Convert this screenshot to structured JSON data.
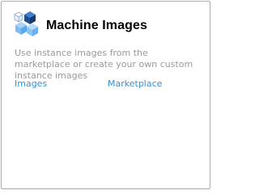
{
  "card": {
    "title": "Machine Images",
    "description": "Use instance images from the marketplace or create your own custom instance images",
    "icon": "stacked-cubes-icon",
    "links": [
      {
        "label": "Images"
      },
      {
        "label": "Marketplace"
      }
    ]
  },
  "colors": {
    "border": "#55d0e6",
    "link": "#3a8fd0",
    "description": "#9a9a9a",
    "cube_dark": "#1e4e8c",
    "cube_light": "#5aa6e8"
  }
}
